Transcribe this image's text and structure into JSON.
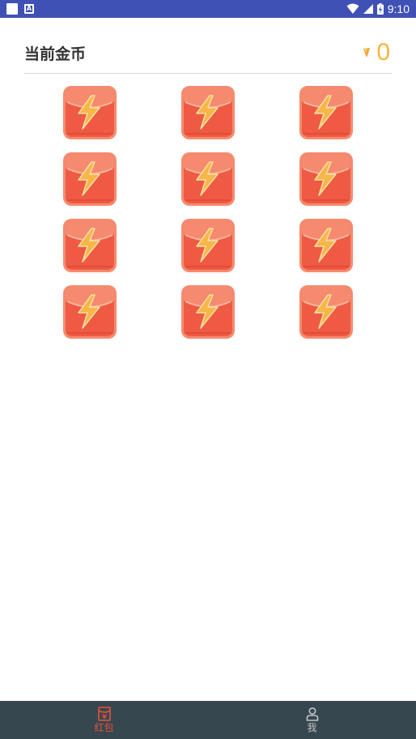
{
  "status_bar": {
    "time": "9:10",
    "icons": [
      "notification-square-icon",
      "app-a-icon",
      "wifi-icon",
      "cell-signal-icon",
      "battery-charging-icon"
    ]
  },
  "header": {
    "title": "当前金币",
    "coin_balance": "0",
    "coin_icon": "gold-coin-icon"
  },
  "red_packets": {
    "count": 12,
    "columns": 3,
    "icon": "red-packet-lightning-icon",
    "colors": {
      "body": "#ee5a43",
      "flap": "#f58a6e",
      "bolt": "#f7b648"
    }
  },
  "bottom_nav": {
    "tabs": [
      {
        "label": "红包",
        "icon": "red-packet-tab-icon",
        "active": true
      },
      {
        "label": "我",
        "icon": "person-icon",
        "active": false
      }
    ],
    "colors": {
      "background": "#37474f",
      "active": "#e8503a",
      "inactive": "#bfc4c7"
    }
  }
}
